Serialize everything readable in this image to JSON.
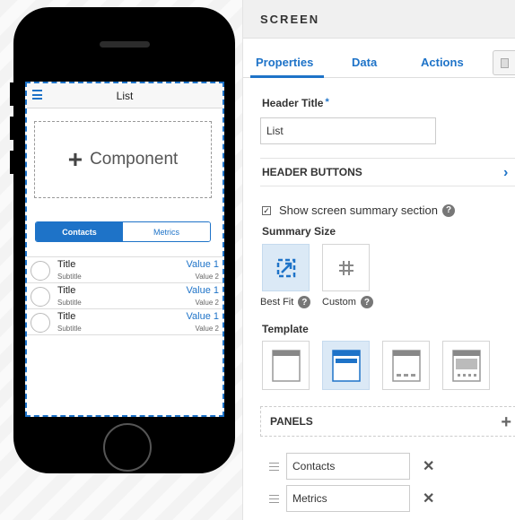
{
  "phone": {
    "screen_title": "List",
    "component_label": "Component",
    "segments": [
      "Contacts",
      "Metrics"
    ],
    "rows": [
      {
        "title": "Title",
        "subtitle": "Subtitle",
        "value1": "Value 1",
        "value2": "Value 2"
      },
      {
        "title": "Title",
        "subtitle": "Subtitle",
        "value1": "Value 1",
        "value2": "Value 2"
      },
      {
        "title": "Title",
        "subtitle": "Subtitle",
        "value1": "Value 1",
        "value2": "Value 2"
      }
    ]
  },
  "panel": {
    "header": "SCREEN",
    "tabs": [
      "Properties",
      "Data",
      "Actions"
    ],
    "active_tab": "Properties",
    "header_title_label": "Header Title",
    "required_mark": "*",
    "header_title_value": "List",
    "header_buttons_label": "HEADER BUTTONS",
    "summary_checkbox_label": "Show screen summary section",
    "summary_checked": true,
    "summary_size_label": "Summary Size",
    "size_options": [
      {
        "label": "Best Fit",
        "icon": "best-fit-icon",
        "selected": true
      },
      {
        "label": "Custom",
        "icon": "hash-icon",
        "selected": false
      }
    ],
    "template_label": "Template",
    "templates": [
      {
        "icon": "template-header-only-icon",
        "selected": false
      },
      {
        "icon": "template-header-summary-icon",
        "selected": true
      },
      {
        "icon": "template-header-footer-icon",
        "selected": false
      },
      {
        "icon": "template-header-body-footer-icon",
        "selected": false
      }
    ],
    "panels_label": "PANELS",
    "panel_items": [
      "Contacts",
      "Metrics"
    ]
  },
  "colors": {
    "accent": "#1e73c8",
    "selected_bg": "#dbe9f6",
    "panel_header_bg": "#f0f0f0"
  }
}
